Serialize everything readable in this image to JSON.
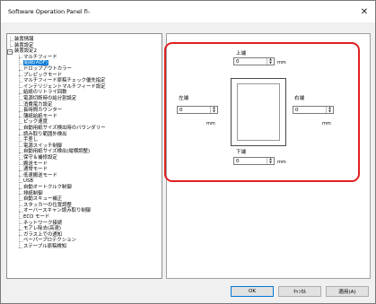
{
  "window": {
    "title": "Software Operation Panel fi-",
    "close_glyph": "✕"
  },
  "tree": [
    "装置情報",
    "装置設定",
    "装置設定2",
    "マルチフィード",
    "給紙(ADF)",
    "ドロップアウトカラー",
    "プレピックモード",
    "マルチフィード原稿チェック優先指定",
    "インテリジェントマルチフィード設定",
    "給紙のリトライ回数",
    "電源切断時の給分割設定",
    "消費電力設定",
    "長時間カウンター",
    "薄紙給紙モード",
    "ピック速度",
    "自動用紙サイズ検出時のバウンダリー",
    "読み取り範囲外検出",
    "手差し",
    "電源スイッチ制御",
    "自動用紙サイズ検出(縦横調整)",
    "保守＆補修設定",
    "搬送モード",
    "通常モード",
    "低速搬送モード",
    "USB",
    "自動オートクルク制御",
    "排紙制御",
    "自動スキュー補正",
    "スタッカーの位置調整",
    "オーバースキャン読み取り制御",
    "ECO モード",
    "ネットワーク接続",
    "モアレ除去(高速)",
    "ガラス上での通知",
    "ペーパープロテクション",
    "ステープル原稿検知"
  ],
  "margins": {
    "top": {
      "label": "上端",
      "value": "0",
      "unit": "mm"
    },
    "left": {
      "label": "左端",
      "value": "0",
      "unit": "mm"
    },
    "right": {
      "label": "右端",
      "value": "0",
      "unit": "mm"
    },
    "bottom": {
      "label": "下端",
      "value": "0",
      "unit": "mm"
    }
  },
  "spin_icons": {
    "up": "▲",
    "down": "▼"
  },
  "buttons": {
    "ok": "OK",
    "cancel": "ｷｬﾝｾﾙ",
    "apply": "適用(A)"
  },
  "colors": {
    "highlight": "#e0201e",
    "selection": "#0078d7"
  }
}
